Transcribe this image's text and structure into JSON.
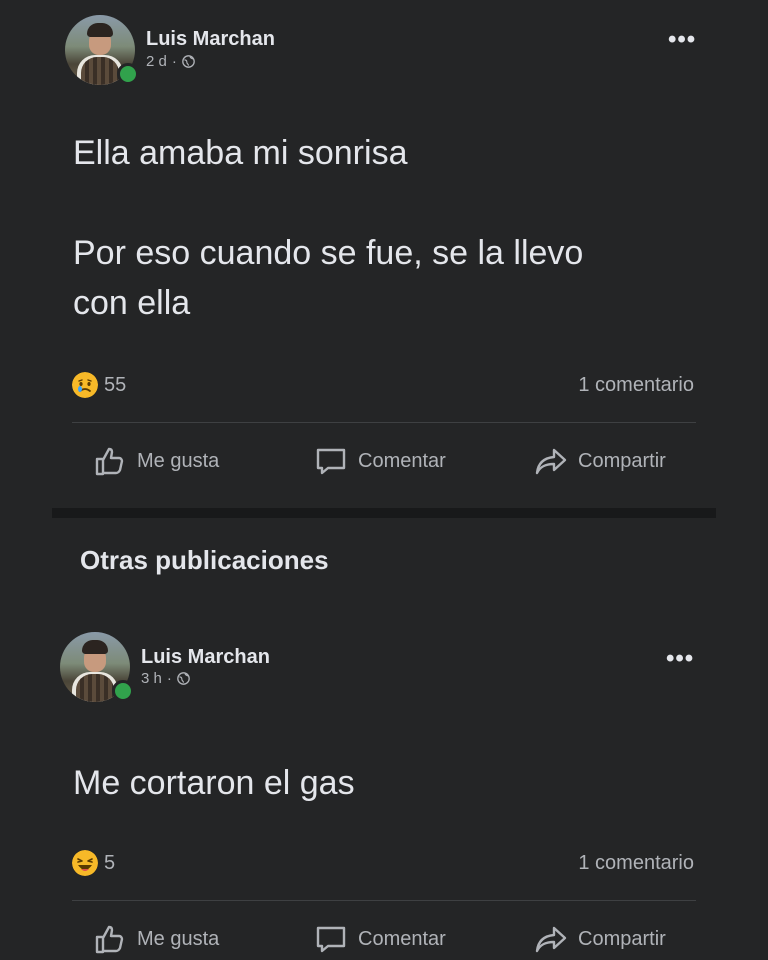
{
  "post1": {
    "author": "Luis Marchan",
    "time": "2 d",
    "text": "Ella amaba mi sonrisa\n\nPor eso cuando se fue, se la llevo\ncon ella",
    "reaction_count": "55",
    "reaction_icon": "sad-emoji-icon",
    "comments": "1 comentario",
    "actions": {
      "like": "Me gusta",
      "comment": "Comentar",
      "share": "Compartir"
    }
  },
  "section_title": "Otras publicaciones",
  "post2": {
    "author": "Luis Marchan",
    "time": "3 h",
    "text": "Me cortaron el gas",
    "reaction_count": "5",
    "reaction_icon": "laugh-emoji-icon",
    "comments": "1 comentario",
    "actions": {
      "like": "Me gusta",
      "comment": "Comentar",
      "share": "Compartir"
    }
  },
  "colors": {
    "background": "#242526",
    "text": "#e4e6eb",
    "secondary_text": "#b0b3b8",
    "online": "#31a24c",
    "emoji_yellow": "#f7b928"
  }
}
